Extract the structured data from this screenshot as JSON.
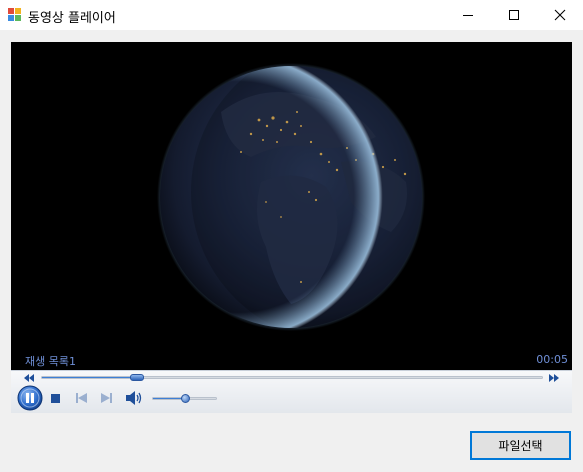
{
  "window": {
    "title": "동영상 플레이어",
    "controls": [
      "minimize",
      "maximize",
      "close"
    ]
  },
  "player": {
    "playlist_label": "재생 목록1",
    "time": "00:05",
    "seek_position": 0.19,
    "volume_level": 0.5,
    "state": "playing",
    "icons": [
      "rewind-icon",
      "fast-forward-icon",
      "pause-icon",
      "stop-icon",
      "previous-icon",
      "next-icon",
      "volume-icon"
    ]
  },
  "buttons": {
    "file_select": "파일선택"
  },
  "colors": {
    "accent": "#0078d7",
    "overlay_text": "#6f8fd6",
    "video_bg": "#000000"
  }
}
